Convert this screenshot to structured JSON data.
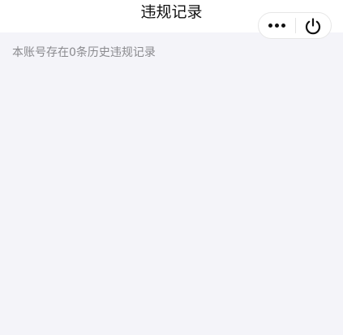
{
  "header": {
    "title": "违规记录"
  },
  "capsule": {
    "more_icon": "more-dots-icon",
    "close_icon": "power-icon"
  },
  "main": {
    "summary_text": "本账号存在0条历史违规记录"
  },
  "colors": {
    "page_background": "#f4f4f9",
    "header_background": "#ffffff",
    "title_text": "#111111",
    "summary_text": "#8a8a8e"
  }
}
